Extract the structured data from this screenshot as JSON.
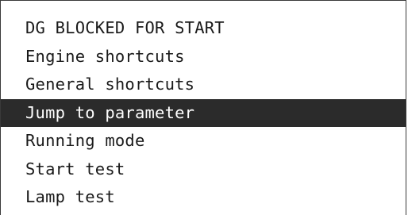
{
  "menu": {
    "items": [
      {
        "label": "DG BLOCKED FOR START"
      },
      {
        "label": "Engine shortcuts"
      },
      {
        "label": "General shortcuts"
      },
      {
        "label": "Jump to parameter",
        "selected": true
      },
      {
        "label": "Running mode"
      },
      {
        "label": "Start test"
      },
      {
        "label": "Lamp test"
      }
    ],
    "colors": {
      "selected_background": "#2b2b2b",
      "selected_text": "#ffffff",
      "text": "#1a1a1a",
      "background": "#ffffff"
    }
  }
}
